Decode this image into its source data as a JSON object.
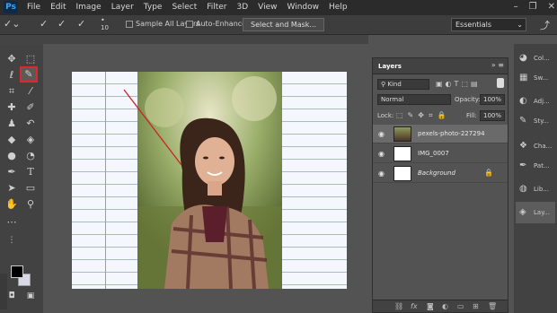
{
  "app": {
    "logo": "Ps"
  },
  "menu": [
    "File",
    "Edit",
    "Image",
    "Layer",
    "Type",
    "Select",
    "Filter",
    "3D",
    "View",
    "Window",
    "Help"
  ],
  "window_controls": [
    "–",
    "❐",
    "✕"
  ],
  "options": {
    "brush_size": "10",
    "sample_all_layers": "Sample All Layers",
    "auto_enhance": "Auto-Enhance",
    "select_and_mask": "Select and Mask...",
    "workspace": "Essentials"
  },
  "tools": [
    "move-icon",
    "marquee-icon",
    "lasso-icon",
    "quick-selection-icon",
    "crop-icon",
    "eyedropper-icon",
    "healing-icon",
    "brush-icon",
    "clone-stamp-icon",
    "history-brush-icon",
    "eraser-icon",
    "paint-bucket-icon",
    "blur-icon",
    "dodge-icon",
    "pen-icon",
    "type-icon",
    "path-selection-icon",
    "shape-icon",
    "hand-icon",
    "zoom-icon"
  ],
  "right_panels": [
    {
      "label": "Col...",
      "icon": "color-icon"
    },
    {
      "label": "Sw...",
      "icon": "swatches-icon"
    },
    {
      "label": "Adj...",
      "icon": "adjustments-icon"
    },
    {
      "label": "Sty...",
      "icon": "styles-icon"
    },
    {
      "label": "Cha...",
      "icon": "channels-icon"
    },
    {
      "label": "Pat...",
      "icon": "paths-icon"
    },
    {
      "label": "Lib...",
      "icon": "libraries-icon"
    },
    {
      "label": "Lay...",
      "icon": "layers-icon"
    }
  ],
  "layers_panel": {
    "title": "Layers",
    "kind": "Kind",
    "blend_mode": "Normal",
    "opacity_label": "Opacity:",
    "opacity_value": "100%",
    "lock_label": "Lock:",
    "fill_label": "Fill:",
    "fill_value": "100%",
    "layers": [
      {
        "name": "pexels-photo-227294",
        "selected": true
      },
      {
        "name": "IMG_0007",
        "selected": false
      },
      {
        "name": "Background",
        "selected": false
      }
    ]
  },
  "colors": {
    "accent_red": "#d92b2b",
    "menubar": "#2b2b2b",
    "panel": "#535353"
  }
}
